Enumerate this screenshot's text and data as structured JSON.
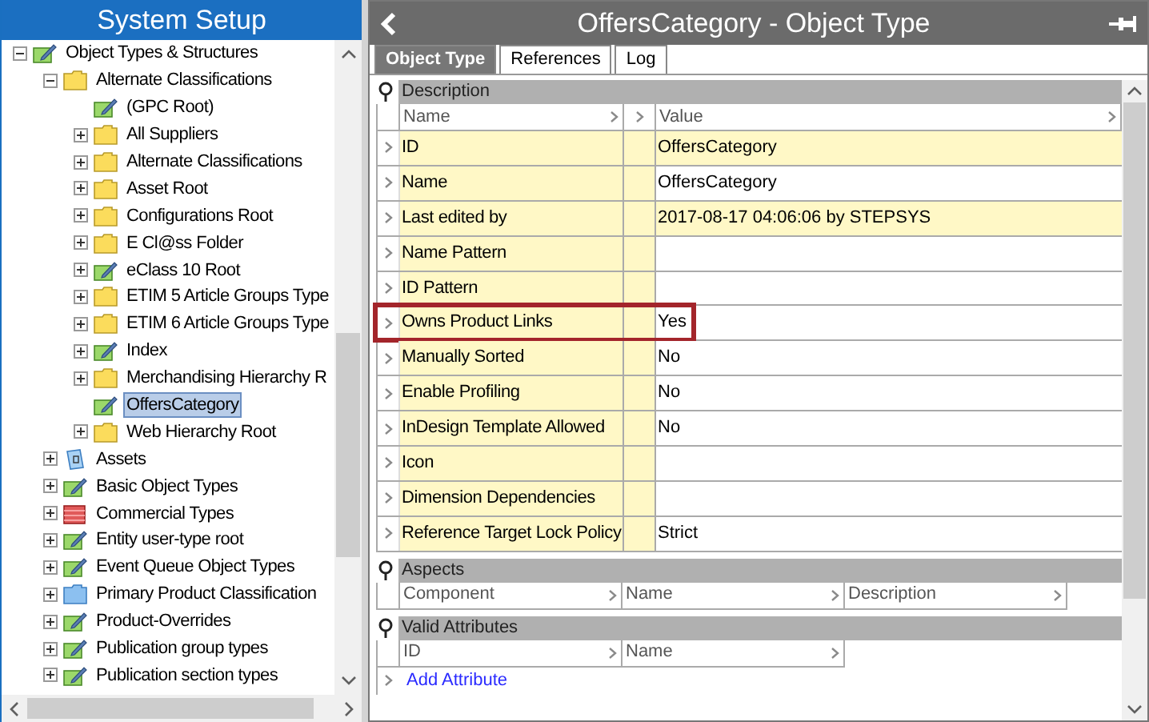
{
  "sidebar": {
    "title": "System Setup",
    "tree": [
      {
        "label": "Object Types & Structures",
        "kind": "type",
        "expanded": true,
        "selected": false,
        "children": [
          {
            "label": "Alternate Classifications",
            "kind": "folder",
            "expanded": true,
            "selected": false,
            "children": [
              {
                "label": "(GPC Root)",
                "kind": "type",
                "selected": false
              },
              {
                "label": "All Suppliers",
                "kind": "folder",
                "expanded": false,
                "selected": false
              },
              {
                "label": "Alternate Classifications",
                "kind": "folder",
                "expanded": false,
                "selected": false
              },
              {
                "label": "Asset Root",
                "kind": "folder",
                "expanded": false,
                "selected": false
              },
              {
                "label": "Configurations Root",
                "kind": "folder",
                "expanded": false,
                "selected": false
              },
              {
                "label": "E Cl@ss Folder",
                "kind": "folder",
                "expanded": false,
                "selected": false
              },
              {
                "label": "eClass 10 Root",
                "kind": "type",
                "expanded": false,
                "selected": false
              },
              {
                "label": "ETIM 5 Article Groups Type",
                "kind": "folder",
                "expanded": false,
                "selected": false
              },
              {
                "label": "ETIM 6 Article Groups Type",
                "kind": "folder",
                "expanded": false,
                "selected": false
              },
              {
                "label": "Index",
                "kind": "type",
                "expanded": false,
                "selected": false
              },
              {
                "label": "Merchandising Hierarchy R",
                "kind": "folder",
                "expanded": false,
                "selected": false
              },
              {
                "label": "OffersCategory",
                "kind": "type",
                "selected": true
              },
              {
                "label": "Web Hierarchy Root",
                "kind": "folder",
                "expanded": false,
                "selected": false
              }
            ]
          },
          {
            "label": "Assets",
            "kind": "asset",
            "expanded": false,
            "selected": false
          },
          {
            "label": "Basic Object Types",
            "kind": "type",
            "expanded": false,
            "selected": false
          },
          {
            "label": "Commercial Types",
            "kind": "table",
            "expanded": false,
            "selected": false
          },
          {
            "label": "Entity user-type root",
            "kind": "type",
            "expanded": false,
            "selected": false
          },
          {
            "label": "Event Queue Object Types",
            "kind": "type",
            "expanded": false,
            "selected": false
          },
          {
            "label": "Primary Product Classification",
            "kind": "bluefolder",
            "expanded": false,
            "selected": false
          },
          {
            "label": "Product-Overrides",
            "kind": "type",
            "expanded": false,
            "selected": false
          },
          {
            "label": "Publication group types",
            "kind": "type",
            "expanded": false,
            "selected": false
          },
          {
            "label": "Publication section types",
            "kind": "type",
            "expanded": false,
            "selected": false
          }
        ]
      }
    ]
  },
  "editor": {
    "title": "OffersCategory - Object Type",
    "tabs": [
      {
        "label": "Object Type",
        "selected": true
      },
      {
        "label": "References",
        "selected": false
      },
      {
        "label": "Log",
        "selected": false
      }
    ],
    "description": {
      "title": "Description",
      "columns": [
        "Name",
        "Value"
      ],
      "rows": [
        {
          "name": "ID",
          "value": "OffersCategory",
          "shaded": true,
          "highlighted": false
        },
        {
          "name": "Name",
          "value": "OffersCategory",
          "shaded": false,
          "highlighted": false
        },
        {
          "name": "Last edited by",
          "value": "2017-08-17 04:06:06 by STEPSYS",
          "shaded": true,
          "highlighted": false
        },
        {
          "name": "Name Pattern",
          "shaded": false,
          "highlighted": false
        },
        {
          "name": "ID Pattern",
          "shaded": false,
          "highlighted": false
        },
        {
          "name": "Owns Product Links",
          "value": "Yes",
          "shaded": false,
          "highlighted": true
        },
        {
          "name": "Manually Sorted",
          "value": "No",
          "shaded": false,
          "highlighted": false
        },
        {
          "name": "Enable Profiling",
          "value": "No",
          "shaded": false,
          "highlighted": false
        },
        {
          "name": "InDesign Template Allowed",
          "value": "No",
          "shaded": false,
          "highlighted": false
        },
        {
          "name": "Icon",
          "shaded": false,
          "highlighted": false
        },
        {
          "name": "Dimension Dependencies",
          "shaded": false,
          "highlighted": false
        },
        {
          "name": "Reference Target Lock Policy",
          "value": "Strict",
          "shaded": false,
          "highlighted": false
        }
      ]
    },
    "aspects": {
      "title": "Aspects",
      "columns": [
        "Component",
        "Name",
        "Description"
      ]
    },
    "valid_attributes": {
      "title": "Valid Attributes",
      "columns": [
        "ID",
        "Name"
      ],
      "link": "Add Attribute"
    }
  }
}
